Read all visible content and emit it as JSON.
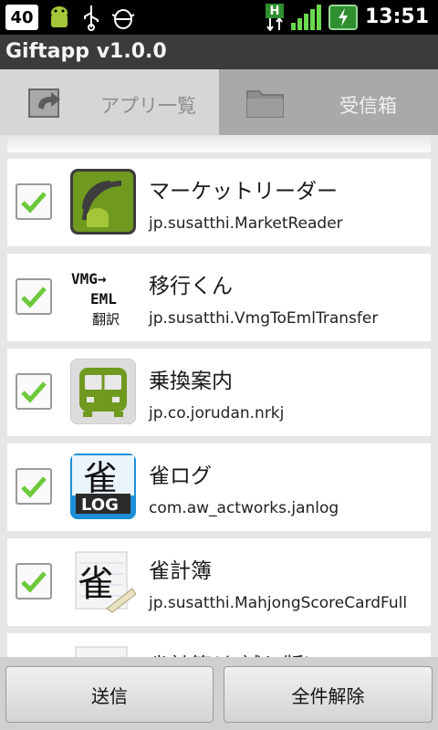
{
  "status_bar": {
    "badge": "40",
    "h_indicator": "H",
    "time": "13:51",
    "icons": [
      "notification-40-icon",
      "android-icon",
      "usb-icon",
      "debug-icon",
      "data-transfer-icon",
      "signal-icon",
      "battery-charging-icon"
    ]
  },
  "app": {
    "title": "Giftapp v1.0.0"
  },
  "tabs": [
    {
      "label": "アプリ一覧",
      "active": true,
      "icon": "refresh-icon"
    },
    {
      "label": "受信箱",
      "active": false,
      "icon": "folder-icon"
    }
  ],
  "apps": [
    {
      "name": "マーケットリーダー",
      "package": "jp.susatthi.MarketReader",
      "checked": true,
      "icon": "market-reader-icon"
    },
    {
      "name": "移行くん",
      "package": "jp.susatthi.VmgToEmlTransfer",
      "checked": true,
      "icon": "vmg-to-eml-icon",
      "icon_text": [
        "VMG→",
        "EML",
        "翻訳"
      ]
    },
    {
      "name": "乗換案内",
      "package": "jp.co.jorudan.nrkj",
      "checked": true,
      "icon": "train-icon"
    },
    {
      "name": "雀ログ",
      "package": "com.aw_actworks.janlog",
      "checked": true,
      "icon": "janlog-icon",
      "icon_text": [
        "雀",
        "LOG"
      ]
    },
    {
      "name": "雀計簿",
      "package": "jp.susatthi.MahjongScoreCardFull",
      "checked": true,
      "icon": "mahjong-scorecard-icon",
      "icon_text": [
        "雀"
      ]
    },
    {
      "name": "雀計簿(お試し版)",
      "package": "",
      "checked": true,
      "icon": "mahjong-scorecard-trial-icon"
    }
  ],
  "buttons": {
    "send": "送信",
    "clear_all": "全件解除"
  },
  "colors": {
    "check": "#6cc93a",
    "title_bar": "#3b3b3b",
    "active_tab": "#d6d6d6",
    "inactive_tab": "#a9a9a9"
  }
}
